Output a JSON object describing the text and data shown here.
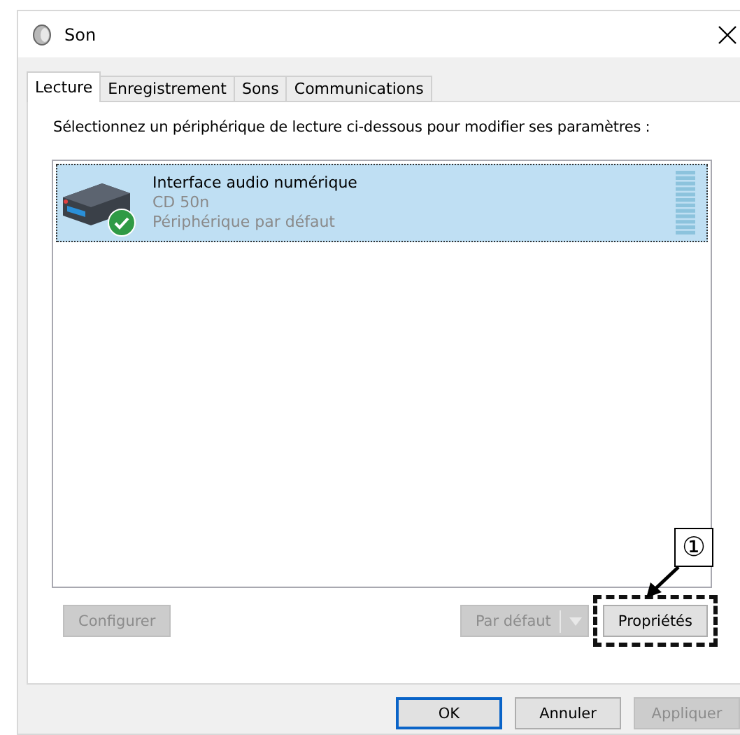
{
  "window": {
    "title": "Son"
  },
  "tabs": [
    {
      "label": "Lecture",
      "selected": true
    },
    {
      "label": "Enregistrement",
      "selected": false
    },
    {
      "label": "Sons",
      "selected": false
    },
    {
      "label": "Communications",
      "selected": false
    }
  ],
  "instruction": "Sélectionnez un périphérique de lecture ci-dessous pour modifier ses paramètres :",
  "devices": [
    {
      "name": "Interface audio numérique",
      "model": "CD 50n",
      "status": "Périphérique par défaut",
      "selected": true,
      "is_default": true
    }
  ],
  "panel_buttons": [
    {
      "label": "Configurer",
      "disabled": true,
      "kind": "plain",
      "highlighted": false
    },
    {
      "label": "Par défaut",
      "disabled": true,
      "kind": "split",
      "highlighted": false
    },
    {
      "label": "Propriétés",
      "disabled": false,
      "kind": "plain",
      "highlighted": true
    }
  ],
  "callout": {
    "label": "①"
  },
  "dialog_buttons": [
    {
      "label": "OK",
      "disabled": false,
      "focused": true
    },
    {
      "label": "Annuler",
      "disabled": false,
      "focused": false
    },
    {
      "label": "Appliquer",
      "disabled": true,
      "focused": false
    }
  ]
}
